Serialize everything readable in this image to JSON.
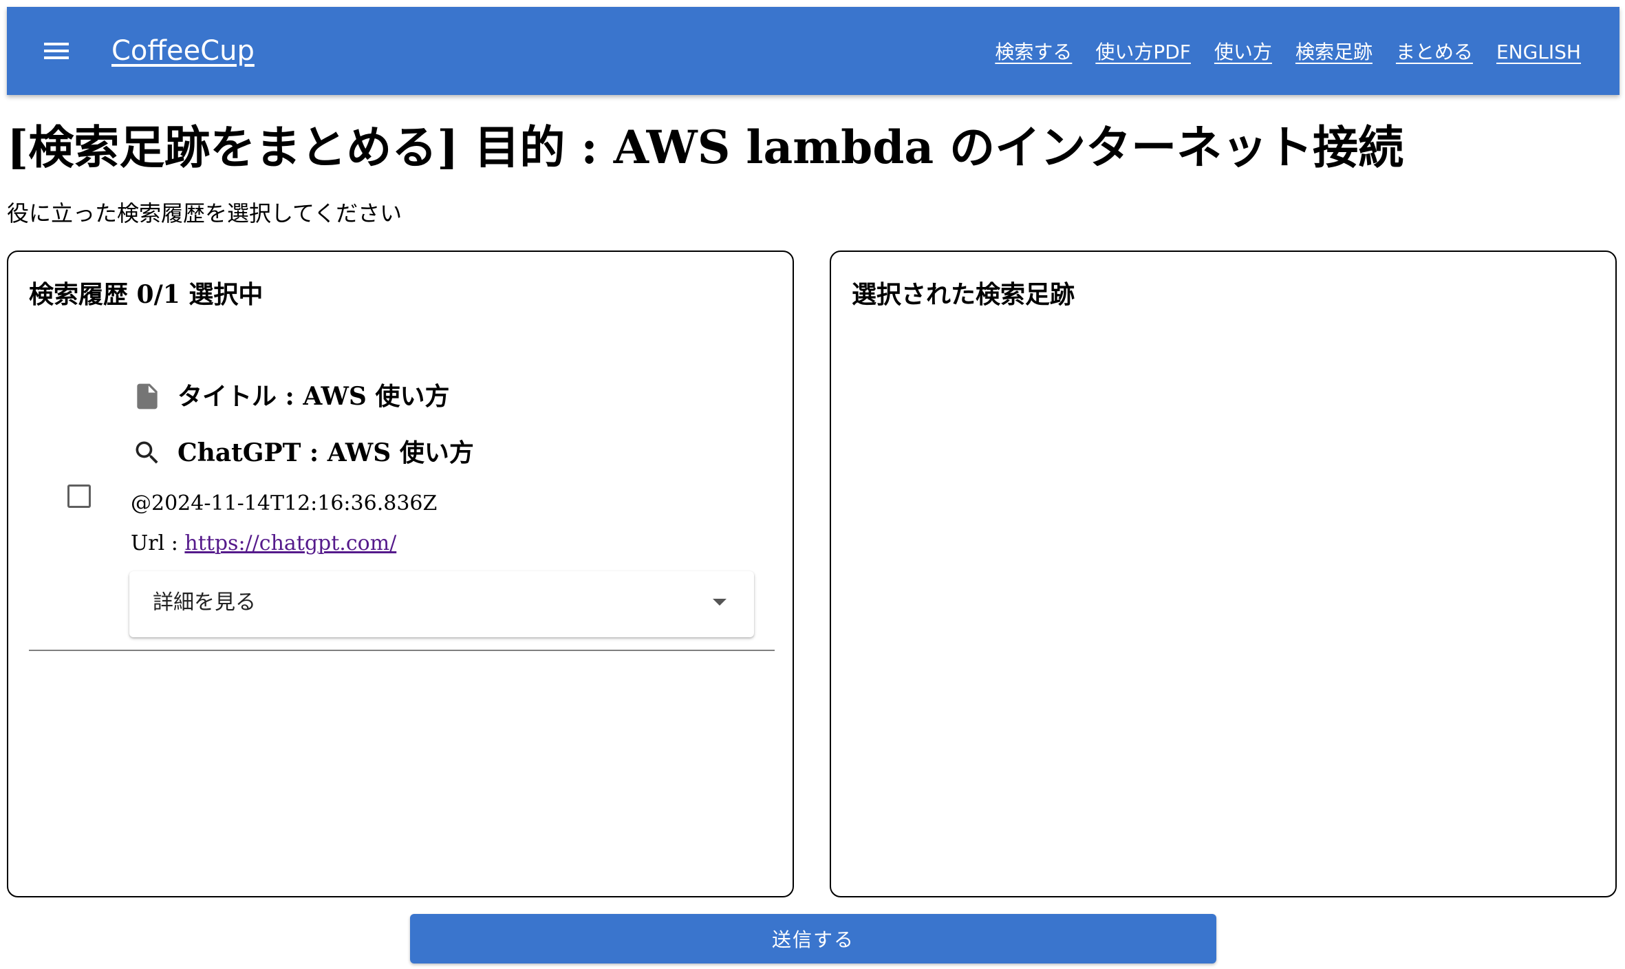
{
  "header": {
    "brand": "CoffeeCup",
    "menu_icon": "hamburger-menu-icon",
    "nav": [
      {
        "label": "検索する"
      },
      {
        "label": "使い方PDF"
      },
      {
        "label": "使い方"
      },
      {
        "label": "検索足跡"
      },
      {
        "label": "まとめる"
      },
      {
        "label": "ENGLISH"
      }
    ],
    "bar_color": "#3a75cd"
  },
  "page": {
    "title": "[検索足跡をまとめる] 目的 : AWS lambda のインターネット接続",
    "subtitle": "役に立った検索履歴を選択してください"
  },
  "history_panel": {
    "heading": "検索履歴 0/1 選択中",
    "items": [
      {
        "checked": false,
        "title_icon": "document-icon",
        "title_text": "タイトル : AWS 使い方",
        "query_icon": "search-icon",
        "query_text": "ChatGPT : AWS 使い方",
        "timestamp": "@2024-11-14T12:16:36.836Z",
        "url_label": "Url : ",
        "url": "https://chatgpt.com/",
        "details_label": "詳細を見る"
      }
    ]
  },
  "selected_panel": {
    "heading": "選択された検索足跡"
  },
  "submit": {
    "label": "送信する",
    "color": "#3a75cd"
  }
}
